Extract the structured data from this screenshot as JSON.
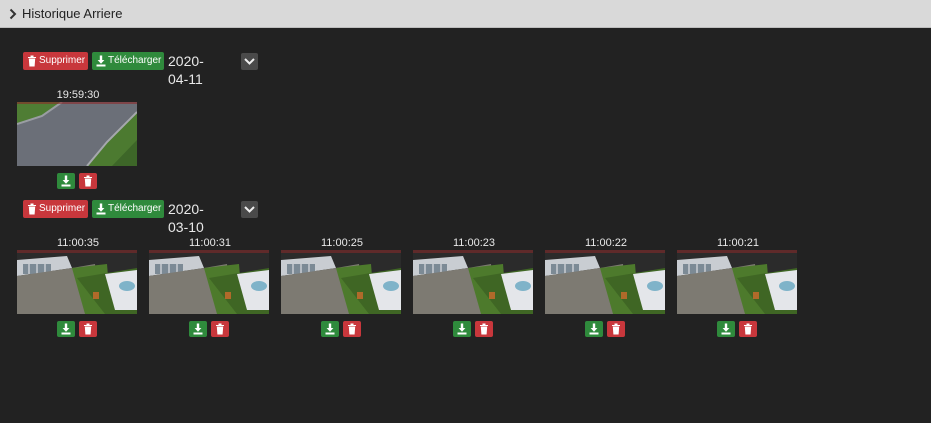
{
  "header": {
    "title": "Historique Arriere",
    "icon": "chevron-right-icon"
  },
  "actions": {
    "delete_label": "Supprimer",
    "download_label": "Télécharger"
  },
  "colors": {
    "delete": "#c8373c",
    "download": "#2f8a3c",
    "background": "#222222",
    "header": "#d9d9d9"
  },
  "groups": [
    {
      "date": "2020-04-11",
      "snapshots": [
        {
          "time": "19:59:30",
          "scene": "driveway"
        }
      ]
    },
    {
      "date": "2020-03-10",
      "snapshots": [
        {
          "time": "11:00:35",
          "scene": "yard"
        },
        {
          "time": "11:00:31",
          "scene": "yard"
        },
        {
          "time": "11:00:25",
          "scene": "yard"
        },
        {
          "time": "11:00:23",
          "scene": "yard"
        },
        {
          "time": "11:00:22",
          "scene": "yard"
        },
        {
          "time": "11:00:21",
          "scene": "yard"
        }
      ]
    }
  ]
}
